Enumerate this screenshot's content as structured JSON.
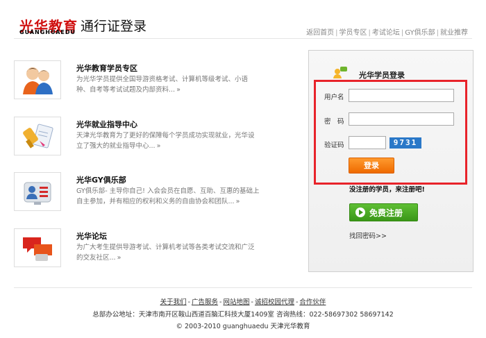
{
  "header": {
    "logo_cn": "光华教育",
    "logo_en": "GUANGHUAEDU",
    "title": "通行证登录",
    "nav": [
      {
        "label": "返回首页"
      },
      {
        "label": "学员专区"
      },
      {
        "label": "考试论坛"
      },
      {
        "label": "GY俱乐部"
      },
      {
        "label": "就业推荐"
      }
    ]
  },
  "features": [
    {
      "title": "光华教育学员专区",
      "desc": "为光华学员提供全国导游资格考试、计算机等级考试、小语种、自考等考试试题及内部资料...",
      "more": "»",
      "icon": "students-icon"
    },
    {
      "title": "光华就业指导中心",
      "desc": "天津光华教育为了更好的保障每个学员成功实现就业，光华设立了强大的就业指导中心...",
      "more": "»",
      "icon": "employment-icon"
    },
    {
      "title": "光华GY俱乐部",
      "desc": "GY俱乐部- 主导你自己! 入会会员在自愿、互助、互惠的基础上自主参加，并有相应的权利和义务的自由协会和团队...",
      "more": "»",
      "icon": "club-icon"
    },
    {
      "title": "光华论坛",
      "desc": "为广大考生提供导游考试、计算机考试等各类考试交流和广泛的交友社区...",
      "more": "»",
      "icon": "forum-icon"
    }
  ],
  "login": {
    "title": "光华学员登录",
    "username_label": "用户名",
    "password_label": "密　码",
    "captcha_label": "验证码",
    "captcha_text": "9731",
    "login_button": "登录",
    "register_note": "没注册的学员，来注册吧!",
    "register_button": "免费注册",
    "forgot_link": "找回密码>>"
  },
  "footer": {
    "links": [
      {
        "label": "关于我们"
      },
      {
        "label": "广告服务"
      },
      {
        "label": "网站地图"
      },
      {
        "label": "诚招校园代理"
      },
      {
        "label": "合作伙伴"
      }
    ],
    "address": "总部办公地址：天津市南开区鞍山西道百脑汇科技大厦1409室 咨询热线：022-58697302 58697142",
    "copyright": "© 2003-2010 guanghuaedu 天津光华教育"
  },
  "colors": {
    "brand_red": "#d01010",
    "highlight_red": "#e8232a",
    "login_orange": "#ee6a00",
    "register_green": "#3a9718"
  }
}
